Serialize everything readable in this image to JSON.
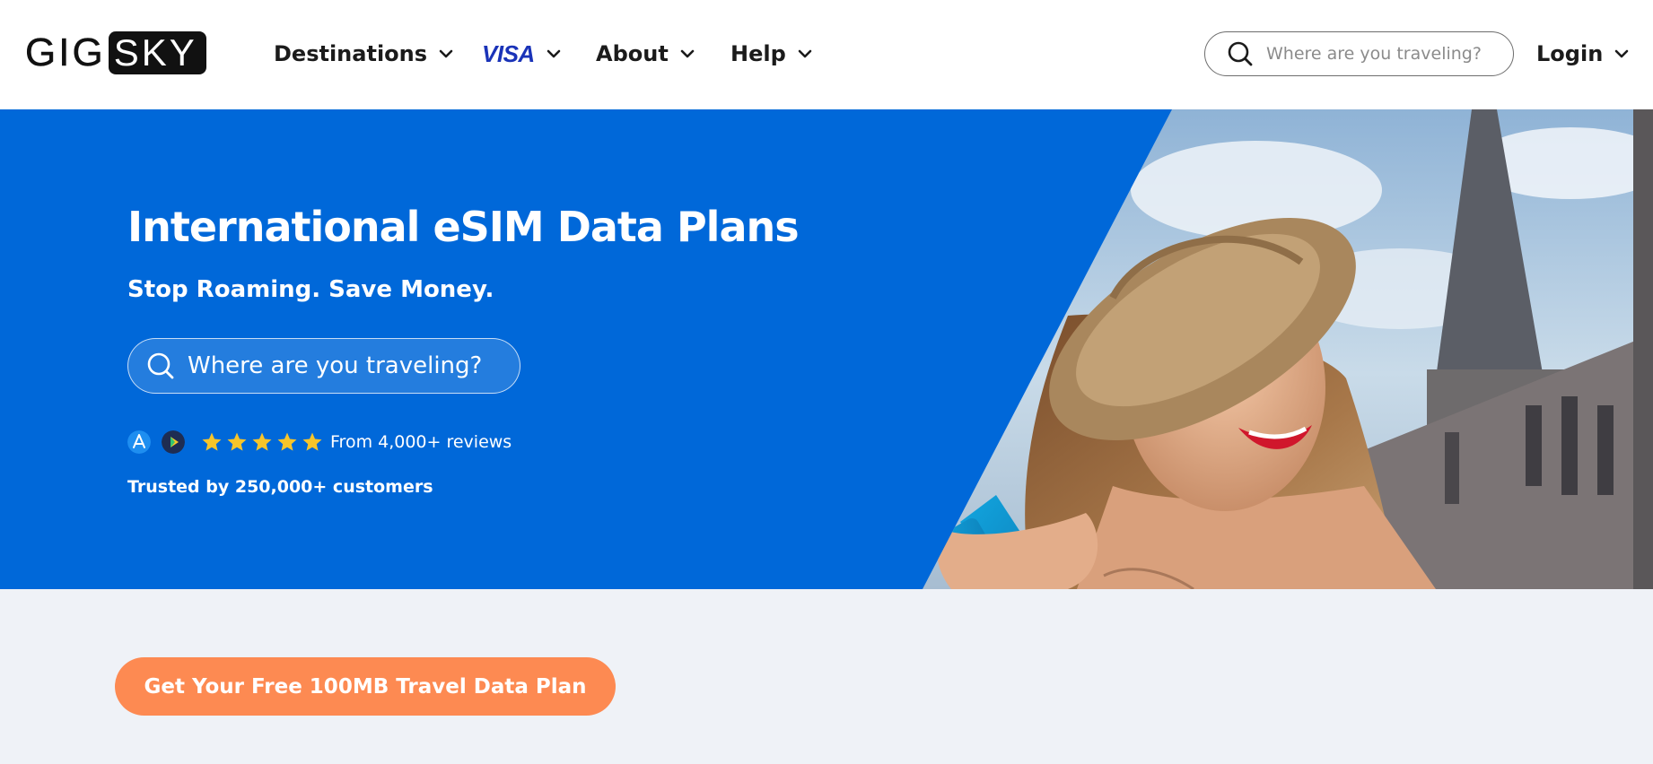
{
  "brand": {
    "logo_left": "GIG",
    "logo_right": "SKY"
  },
  "nav": {
    "items": [
      {
        "label": "Destinations",
        "icon": "chevron-down-icon"
      },
      {
        "label": "VISA",
        "icon": "chevron-down-icon"
      },
      {
        "label": "About",
        "icon": "chevron-down-icon"
      },
      {
        "label": "Help",
        "icon": "chevron-down-icon"
      }
    ],
    "login_label": "Login"
  },
  "header_search": {
    "placeholder": "Where are you traveling?",
    "value": "",
    "icon": "search-icon"
  },
  "hero": {
    "title": "International eSIM Data Plans",
    "subtitle": "Stop Roaming. Save Money.",
    "search": {
      "placeholder": "Where are you traveling?",
      "value": "",
      "icon": "search-icon"
    },
    "store_icons": [
      "app-store-icon",
      "google-play-icon"
    ],
    "rating_stars": 5,
    "reviews_text": "From 4,000+ reviews",
    "trusted_text": "Trusted by 250,000+ customers"
  },
  "cta": {
    "label": "Get Your Free 100MB Travel Data Plan"
  },
  "colors": {
    "hero_blue": "#0068d9",
    "cta_orange": "#fd8a52",
    "visa_blue": "#1a33b8",
    "star_yellow": "#f7c52a",
    "page_bg": "#eff2f7"
  }
}
